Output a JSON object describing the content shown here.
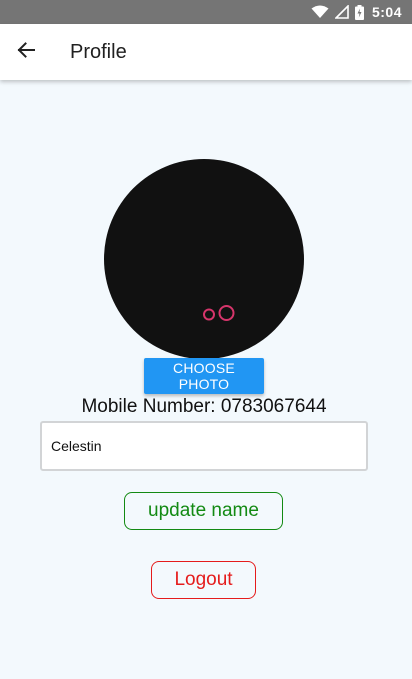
{
  "status_bar": {
    "time": "5:04",
    "icons": [
      "wifi-icon",
      "signal-icon",
      "battery-icon"
    ]
  },
  "app_bar": {
    "back_icon": "arrow-left-icon",
    "title": "Profile"
  },
  "profile": {
    "avatar_icon": "eyes-icon",
    "choose_photo_label": "CHOOSE PHOTO",
    "mobile_number_text": "Mobile Number: 0783067644",
    "name_value": "Celestin",
    "update_name_label": "update name",
    "logout_label": "Logout"
  },
  "colors": {
    "background": "#f3f9fd",
    "status_bar": "#757575",
    "primary_button": "#2196f3",
    "update_accent": "#138a13",
    "logout_accent": "#e51c1c",
    "avatar_eyes": "#d6356b"
  }
}
